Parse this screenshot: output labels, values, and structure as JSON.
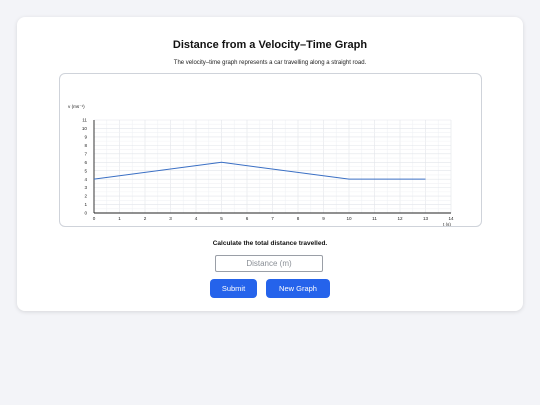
{
  "page": {
    "title": "Distance from a Velocity–Time Graph",
    "subtitle": "The velocity–time graph represents a car travelling along a straight road.",
    "prompt": "Calculate the total distance travelled.",
    "answer": {
      "placeholder": "Distance (m)",
      "value": ""
    },
    "buttons": {
      "submit": "Submit",
      "new_graph": "New Graph"
    }
  },
  "chart_data": {
    "type": "line",
    "xlabel": "t (s)",
    "ylabel": "v (ms⁻¹)",
    "xlim": [
      0,
      14
    ],
    "ylim": [
      0,
      11
    ],
    "x_ticks": [
      0,
      1,
      2,
      3,
      4,
      5,
      6,
      7,
      8,
      9,
      10,
      11,
      12,
      13,
      14
    ],
    "y_ticks": [
      0,
      1,
      2,
      3,
      4,
      5,
      6,
      7,
      8,
      9,
      10,
      11
    ],
    "grid": true,
    "series": [
      {
        "x": [
          0,
          5,
          10,
          13
        ],
        "y": [
          4,
          6,
          4,
          4
        ],
        "color": "#3a6fc4"
      }
    ]
  }
}
